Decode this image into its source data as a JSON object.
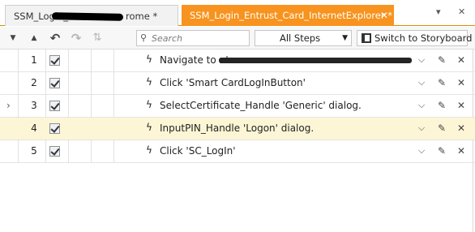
{
  "tabs": [
    {
      "label": "SSM_Login_",
      "tail": "rome *",
      "active": false
    },
    {
      "label": "SSM_Login_Entrust_Card_InternetExplorer *",
      "close": "✕",
      "active": true
    }
  ],
  "tabbar_controls": {
    "menu": "▾",
    "close": "✕"
  },
  "toolbar": {
    "search_placeholder": "Search",
    "steps_filter": "All Steps",
    "storyboard_label": "Switch to Storyboard"
  },
  "steps": [
    {
      "number": "1",
      "checked": true,
      "description": "Navigate to : '",
      "expandable": false,
      "highlighted": false
    },
    {
      "number": "2",
      "checked": true,
      "description": "Click 'Smart CardLogInButton'",
      "expandable": false,
      "highlighted": false
    },
    {
      "number": "3",
      "checked": true,
      "description": "SelectCertificate_Handle 'Generic' dialog.",
      "expandable": true,
      "highlighted": false
    },
    {
      "number": "4",
      "checked": true,
      "description": "InputPIN_Handle 'Logon' dialog.",
      "expandable": false,
      "highlighted": true
    },
    {
      "number": "5",
      "checked": true,
      "description": "Click 'SC_LogIn'",
      "expandable": false,
      "highlighted": false
    }
  ],
  "colors": {
    "active_tab": "#f7931e",
    "highlight_row": "#fdf6d6"
  }
}
